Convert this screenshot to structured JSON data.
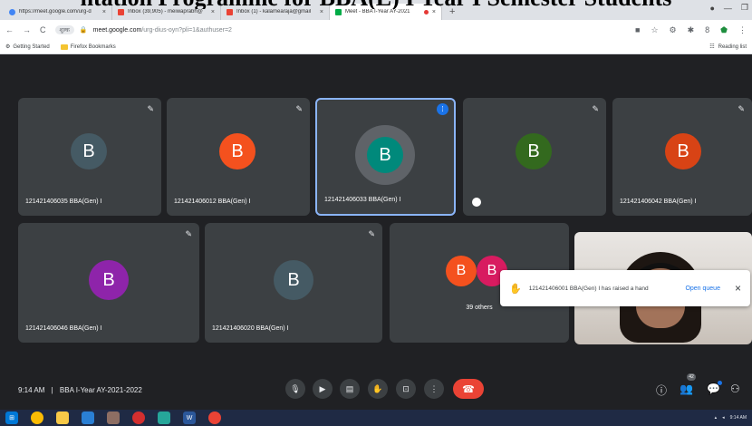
{
  "banner": {
    "text": "ntation Programme for BBA(E) I Year I Semester Students"
  },
  "browser": {
    "tabs": [
      {
        "title": "https://meet.google.com/urg-d",
        "active": false,
        "favicon": "google-icon"
      },
      {
        "title": "Inbox (39,905) - meiwaprabh@",
        "active": false,
        "favicon": "gmail-icon"
      },
      {
        "title": "Inbox (1) - kalamearaja@gmail",
        "active": false,
        "favicon": "gmail-icon"
      },
      {
        "title": "Meet - BBA I-Year AY-2021",
        "active": true,
        "favicon": "meet-icon"
      }
    ],
    "new_tab": "+",
    "close": "×",
    "url_pill": "शुल्क",
    "url_host": "meet.google.com",
    "url_path": "/urg-dius-oyn?pli=1&authuser=2",
    "bookmarks": [
      {
        "label": "Getting Started"
      },
      {
        "label": "Firefox Bookmarks"
      }
    ],
    "reading_list": "Reading list"
  },
  "participants": [
    {
      "name": "121421406035 BBA(Gen) I",
      "initial": "B",
      "avatar_color": "#455a64",
      "muted": true
    },
    {
      "name": "121421406012 BBA(Gen) I",
      "initial": "B",
      "avatar_color": "#f4511e",
      "muted": true
    },
    {
      "name": "121421406033 BBA(Gen) I",
      "initial": "B",
      "avatar_color": "#00897b",
      "muted": false,
      "speaking": true
    },
    {
      "name": "",
      "initial": "B",
      "avatar_color": "#33691e",
      "muted": true
    },
    {
      "name": "121421406042 BBA(Gen) I",
      "initial": "B",
      "avatar_color": "#d84315",
      "muted": true
    },
    {
      "name": "121421406046 BBA(Gen) I",
      "initial": "B",
      "avatar_color": "#8e24aa",
      "muted": true
    },
    {
      "name": "121421406020 BBA(Gen) I",
      "initial": "B",
      "avatar_color": "#455a64",
      "muted": true
    }
  ],
  "others": {
    "label": "39 others",
    "avatars": [
      {
        "initial": "B",
        "color": "#f4511e"
      },
      {
        "initial": "B",
        "color": "#d81b60"
      }
    ]
  },
  "toast": {
    "message": "121421406001 BBA(Gen) I has raised a hand",
    "action": "Open queue",
    "close": "×"
  },
  "meeting": {
    "time": "9:14 AM",
    "separator": "|",
    "title": "BBA I-Year AY-2021-2022",
    "participant_count": "42"
  },
  "taskbar": {
    "time": "9:14 AM",
    "apps": [
      "windows-start-icon",
      "chrome-icon",
      "file-explorer-icon",
      "edge-icon",
      "ftp-icon",
      "opera-icon",
      "image-viewer-icon",
      "word-icon",
      "chrome-icon"
    ]
  }
}
